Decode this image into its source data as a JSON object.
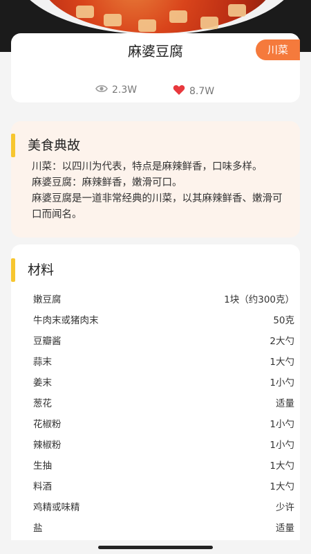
{
  "dish": {
    "title": "麻婆豆腐",
    "tag": "川菜",
    "views": "2.3W",
    "likes": "8.7W"
  },
  "story": {
    "title": "美食典故",
    "lines": [
      "川菜：以四川为代表，特点是麻辣鲜香，口味多样。",
      "麻婆豆腐：麻辣鲜香，嫩滑可口。",
      "麻婆豆腐是一道非常经典的川菜，以其麻辣鲜香、嫩滑可",
      "口而闻名。"
    ]
  },
  "materials": {
    "title": "材料",
    "items": [
      {
        "name": "嫩豆腐",
        "amount": "1块（约300克）"
      },
      {
        "name": "牛肉末或猪肉末",
        "amount": "50克"
      },
      {
        "name": "豆瓣酱",
        "amount": "2大勺"
      },
      {
        "name": "蒜末",
        "amount": "1大勺"
      },
      {
        "name": "姜末",
        "amount": "1小勺"
      },
      {
        "name": "葱花",
        "amount": "适量"
      },
      {
        "name": "花椒粉",
        "amount": "1小勺"
      },
      {
        "name": "辣椒粉",
        "amount": "1小勺"
      },
      {
        "name": "生抽",
        "amount": "1大勺"
      },
      {
        "name": "料酒",
        "amount": "1大勺"
      },
      {
        "name": "鸡精或味精",
        "amount": "少许"
      },
      {
        "name": "盐",
        "amount": "适量"
      }
    ]
  },
  "colors": {
    "tag_bg": "#f57a3c",
    "accent_bar": "#f7c62f",
    "heart": "#e8383d",
    "story_bg": "#fdf3ec"
  },
  "icons": [
    "eye-icon",
    "heart-icon"
  ]
}
